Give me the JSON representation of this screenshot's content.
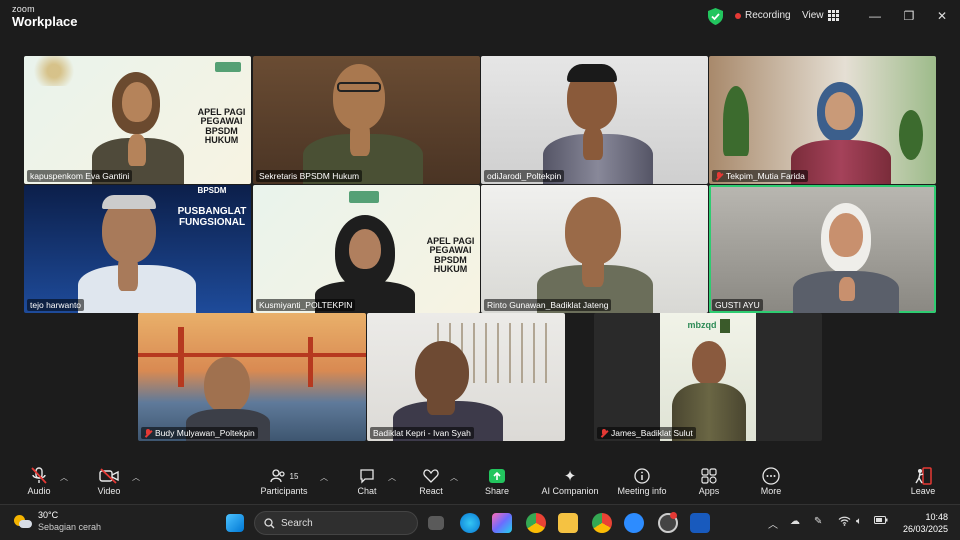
{
  "app": {
    "logo_line1": "zoom",
    "logo_line2": "Workplace"
  },
  "titlebar": {
    "recording_label": "Recording",
    "view_label": "View",
    "minimize": "—",
    "maximize": "❐",
    "close": "✕"
  },
  "participants": [
    {
      "name": "kapuspenkom Eva Gantini",
      "muted": false,
      "banner": "APEL PAGI\nPEGAWAI\nBPSDM\nHUKUM",
      "logo": "bpsdm"
    },
    {
      "name": "Sekretaris BPSDM Hukum",
      "muted": false
    },
    {
      "name": "odiJarodi_Poltekpin",
      "muted": false
    },
    {
      "name": "Tekpim_Mutia Farida",
      "muted": true
    },
    {
      "name": "tejo harwanto",
      "muted": false,
      "banner": "BPSDM",
      "banner2": "PUSBANGLAT\nFUNGSIONAL"
    },
    {
      "name": "Kusmiyanti_POLTEKPIN",
      "muted": false,
      "banner": "APEL PAGI\nPEGAWAI\nBPSDM\nHUKUM",
      "logo": "bpsdm"
    },
    {
      "name": "Rinto Gunawan_Badiklat Jateng",
      "muted": false
    },
    {
      "name": "GUSTI AYU",
      "muted": false,
      "active": true
    },
    {
      "name": "Budy Mulyawan_Poltekpin",
      "muted": true
    },
    {
      "name": "Badiklat Kepri - Ivan Syah",
      "muted": false
    },
    {
      "name": "James_Badiklat Sulut",
      "muted": true,
      "logo": "mbzqd"
    }
  ],
  "toolbar": {
    "audio": "Audio",
    "video": "Video",
    "participants": "Participants",
    "participants_count": "15",
    "chat": "Chat",
    "react": "React",
    "share": "Share",
    "ai": "AI Companion",
    "meeting_info": "Meeting info",
    "apps": "Apps",
    "more": "More",
    "leave": "Leave"
  },
  "taskbar": {
    "temp": "30°C",
    "weather": "Sebagian cerah",
    "search_placeholder": "Search",
    "time": "10:48",
    "date": "26/03/2025"
  }
}
